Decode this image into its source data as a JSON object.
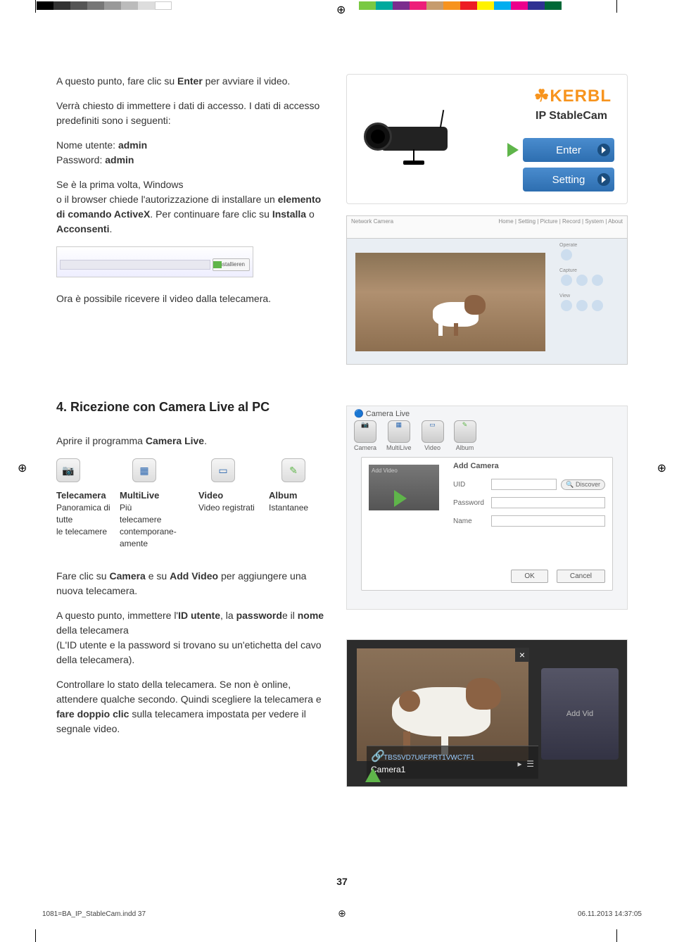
{
  "intro": {
    "p1_a": "A questo punto, fare clic su ",
    "p1_b": "Enter",
    "p1_c": " per avviare il video.",
    "p2": "Verrà chiesto di immettere i dati di accesso. I dati di accesso predefiniti sono i seguenti:",
    "user_label": "Nome utente: ",
    "user_value": "admin",
    "pass_label": "Password: ",
    "pass_value": "admin",
    "p3a": "Se è la prima volta, Windows",
    "p3b": "o il browser chiede l'autorizzazione di installare un ",
    "p3c": "elemento di comando ActiveX",
    "p3d": ". Per continuare fare clic su ",
    "p3e": "Installa",
    "p3f": " o ",
    "p3g": "Acconsenti",
    "p3h": ".",
    "install_btn": "Installieren",
    "p4": "Ora è possibile ricevere il video dalla telecamera."
  },
  "section4": {
    "heading": "4. Ricezione con Camera Live al PC",
    "open_a": "Aprire il programma ",
    "open_b": "Camera Live",
    "open_c": ".",
    "icons": {
      "cam": {
        "title": "Telecamera",
        "desc": "Panoramica di tutte\nle telecamere",
        "tab": "Camera"
      },
      "multi": {
        "title": "MultiLive",
        "desc": "Più\ntelecamere contemporane-amente",
        "tab": "MultiLive"
      },
      "video": {
        "title": "Video",
        "desc": "Video registrati",
        "tab": "Video"
      },
      "album": {
        "title": "Album",
        "desc": "Istantanee",
        "tab": "Album"
      }
    },
    "p1a": "Fare clic su ",
    "p1b": "Camera",
    "p1c": " e su ",
    "p1d": "Add Video",
    "p1e": " per aggiungere una nuova telecamera.",
    "p2a": "A questo punto, immettere l'",
    "p2b": "ID utente",
    "p2c": ", la ",
    "p2d": "password",
    "p2e": "e il ",
    "p2f": "nome",
    "p2g": " della telecamera",
    "p2h": "(L'ID utente e la password si trovano su un'etichetta del cavo della telecamera).",
    "p3a": "Controllare lo stato della telecamera. Se non è online, attendere qualche secondo. Quindi scegliere la telecamera e ",
    "p3b": "fare doppio clic",
    "p3c": " sulla telecamera impostata per vedere il segnale video."
  },
  "kerbl": {
    "logo": "☘KERBL",
    "sub": "IP StableCam",
    "enter": "Enter",
    "setting": "Setting"
  },
  "ie": {
    "title": "Network Camera",
    "top_right": "Home | Setting | Picture | Record | System | About"
  },
  "camlive": {
    "title": "Camera Live",
    "tabs": [
      "Camera",
      "MultiLive",
      "Video",
      "Album"
    ],
    "panel_title": "Add Camera",
    "fields": {
      "uid": "UID",
      "password": "Password",
      "name": "Name"
    },
    "discover": "Discover",
    "ok": "OK",
    "cancel": "Cancel",
    "add_tabs": "Add Video"
  },
  "cam1": {
    "uid": "TBS5VD7U6FPRT1VWC7F1",
    "name": "Camera1",
    "addvid": "Add Vid",
    "close": "×",
    "play": "▸",
    "menu": "☰"
  },
  "page_num": "37",
  "footer_left": "1081=BA_IP_StableCam.indd   37",
  "footer_right": "06.11.2013   14:37:05"
}
